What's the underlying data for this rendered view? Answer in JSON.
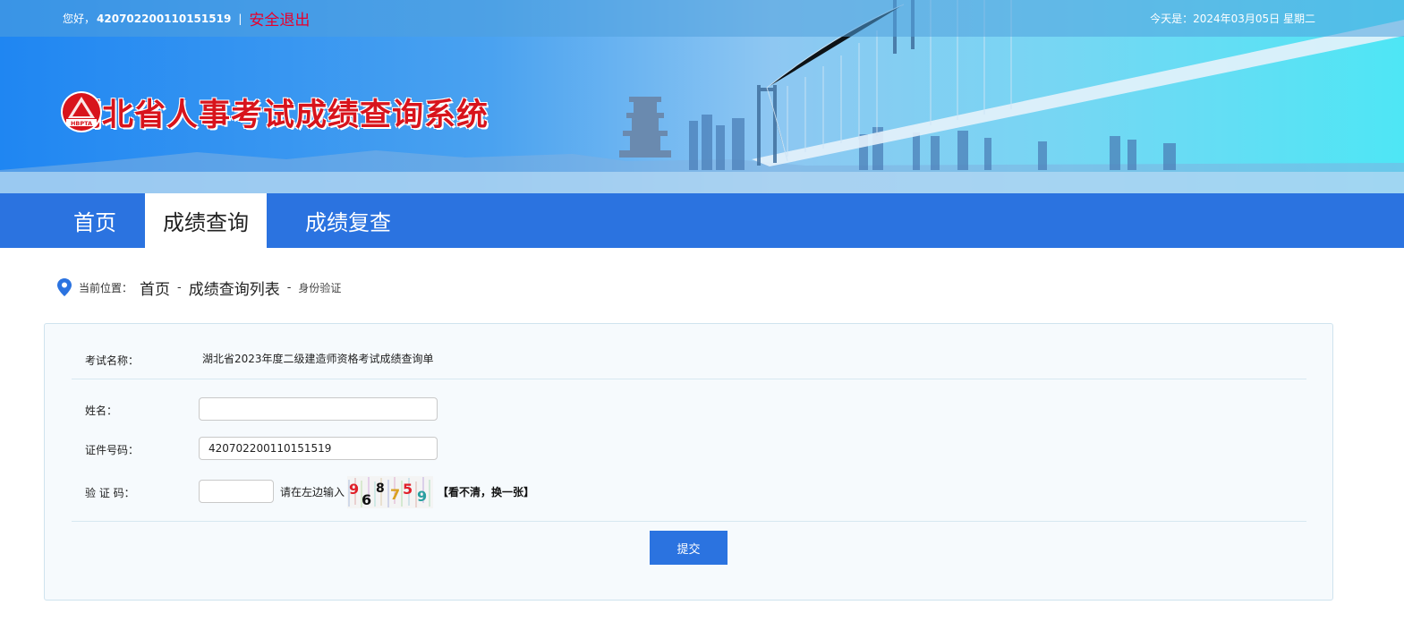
{
  "header": {
    "greeting": "您好，",
    "user_id": "420702200110151519",
    "separator": "|",
    "logout": "安全退出",
    "date_text": "今天是：2024年03月05日 星期二"
  },
  "banner": {
    "logo_text": "HBPTA",
    "title": "湖北省人事考试成绩查询系统"
  },
  "nav": {
    "items": [
      {
        "label": "首页"
      },
      {
        "label": "成绩查询"
      },
      {
        "label": "成绩复查"
      }
    ],
    "active_index": 1
  },
  "breadcrumb": {
    "prefix": "当前位置：",
    "home": "首页",
    "sep": "-",
    "list": "成绩查询列表",
    "current": "身份验证"
  },
  "form": {
    "exam_label": "考试名称：",
    "exam_value": "湖北省2023年度二级建造师资格考试成绩查询单",
    "name_label": "姓名：",
    "name_value": "",
    "id_label": "证件号码：",
    "id_value": "420702200110151519",
    "code_label": "验 证 码：",
    "code_value": "",
    "code_hint": "请在左边输入",
    "captcha_text": "968759",
    "refresh": "【看不清，换一张】",
    "submit": "提交"
  },
  "colors": {
    "nav_bg": "#2b73e0",
    "title_red": "#d8141c",
    "logout_red": "#e8002d"
  }
}
